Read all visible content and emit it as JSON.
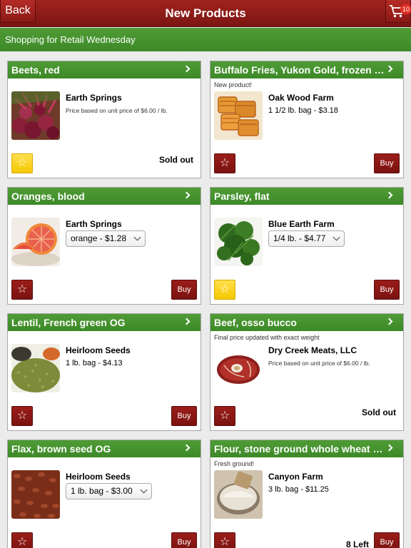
{
  "nav": {
    "back_label": "Back",
    "title": "New Products",
    "cart_count": "10",
    "cart_icon": "shopping-cart-icon"
  },
  "subheader": "Shopping for Retail Wednesday",
  "colors": {
    "header_red": "#8e1c18",
    "header_green": "#469430",
    "favorite_yellow": "#f5c800"
  },
  "products": [
    {
      "name": "Beets, red",
      "note": "",
      "farm": "Earth Springs",
      "detail": "Price based on unit price of $6.00 / lb.",
      "detail_small": true,
      "select": "",
      "favorite": true,
      "buy": "",
      "status": "Sold out",
      "thumb": "beets"
    },
    {
      "name": "Buffalo Fries, Yukon Gold, frozen OG",
      "note": "New product!",
      "farm": "Oak Wood Farm",
      "detail": "1 1/2 lb. bag - $3.18",
      "detail_small": false,
      "select": "",
      "favorite": false,
      "buy": "Buy",
      "status": "",
      "thumb": "fries"
    },
    {
      "name": "Oranges, blood",
      "note": "",
      "farm": "Earth Springs",
      "detail": "",
      "detail_small": false,
      "select": "orange - $1.28",
      "favorite": false,
      "buy": "Buy",
      "status": "",
      "thumb": "orange"
    },
    {
      "name": "Parsley, flat",
      "note": "",
      "farm": "Blue Earth Farm",
      "detail": "",
      "detail_small": false,
      "select": "1/4 lb. - $4.77",
      "favorite": true,
      "buy": "Buy",
      "status": "",
      "thumb": "parsley"
    },
    {
      "name": "Lentil, French green OG",
      "note": "",
      "farm": "Heirloom Seeds",
      "detail": "1 lb. bag - $4.13",
      "detail_small": false,
      "select": "",
      "favorite": false,
      "buy": "Buy",
      "status": "",
      "thumb": "lentil"
    },
    {
      "name": "Beef, osso bucco",
      "note": "Final price updated with exact weight",
      "farm": "Dry Creek Meats, LLC",
      "detail": "Price based on unit price of $6.00 / lb.",
      "detail_small": true,
      "select": "",
      "favorite": false,
      "buy": "",
      "status": "Sold out",
      "thumb": "beef"
    },
    {
      "name": "Flax, brown seed OG",
      "note": "",
      "farm": "Heirloom Seeds",
      "detail": "",
      "detail_small": false,
      "select": "1 lb. bag - $3.00",
      "favorite": false,
      "buy": "Buy",
      "status": "",
      "thumb": "flax"
    },
    {
      "name": "Flour, stone ground whole wheat OG",
      "note": "Fresh ground!",
      "farm": "Canyon Farm",
      "detail": "3 lb. bag - $11.25",
      "detail_small": false,
      "select": "",
      "favorite": false,
      "buy": "Buy",
      "status": "8 Left",
      "thumb": "flour"
    }
  ]
}
